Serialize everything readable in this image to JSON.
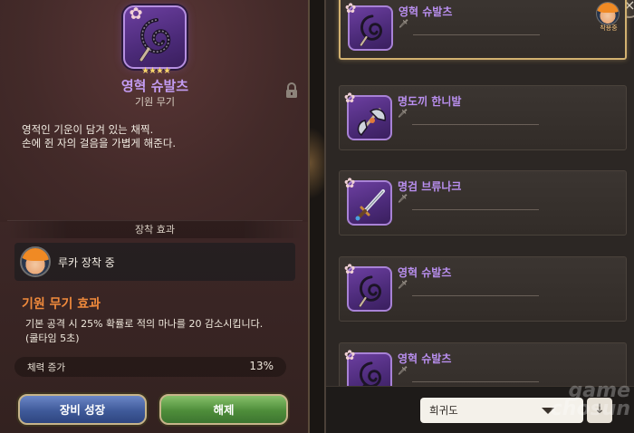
{
  "detail": {
    "weapon_name": "영혁 슈발츠",
    "weapon_type": "기원 무기",
    "stars": "★★★★",
    "description_lines": [
      "영적인 기운이 담겨 있는 채찍.",
      "손에 쥔 자의 걸음을 가볍게 해준다."
    ],
    "equip_section_title": "장착 효과",
    "equipped_by_label": "루카 장착 중",
    "effect_title": "기원 무기 효과",
    "effect_desc_lines": [
      "기본 공격 시 25% 확률로 적의 마나를 20 감소시킵니다.",
      "(쿨타임 5초)"
    ],
    "stat_label": "체력 증가",
    "stat_value": "13%",
    "buttons": {
      "growth": "장비 성장",
      "release": "해제"
    },
    "icons": [
      "flower-icon",
      "whip-icon",
      "lock-icon"
    ]
  },
  "list": {
    "items": [
      {
        "name": "영혁 슈발츠",
        "selected": true,
        "equipped_label": "착용중",
        "weapon": "whip"
      },
      {
        "name": "명도끼 한니발",
        "selected": false,
        "weapon": "axe"
      },
      {
        "name": "명검 브류나크",
        "selected": false,
        "weapon": "sword"
      },
      {
        "name": "영혁 슈발츠",
        "selected": false,
        "weapon": "whip"
      },
      {
        "name": "영혁 슈발츠",
        "selected": false,
        "weapon": "whip"
      }
    ],
    "sort_label": "희귀도",
    "close_symbol": "×",
    "sort_order_symbol": "↓"
  },
  "watermark": "game chosun",
  "colors": {
    "accent_purple": "#b98fef",
    "effect_orange": "#f08a3c",
    "growth_button": "#3f5a9a",
    "release_button": "#4e8d3a",
    "selected_border": "#d2b170"
  }
}
